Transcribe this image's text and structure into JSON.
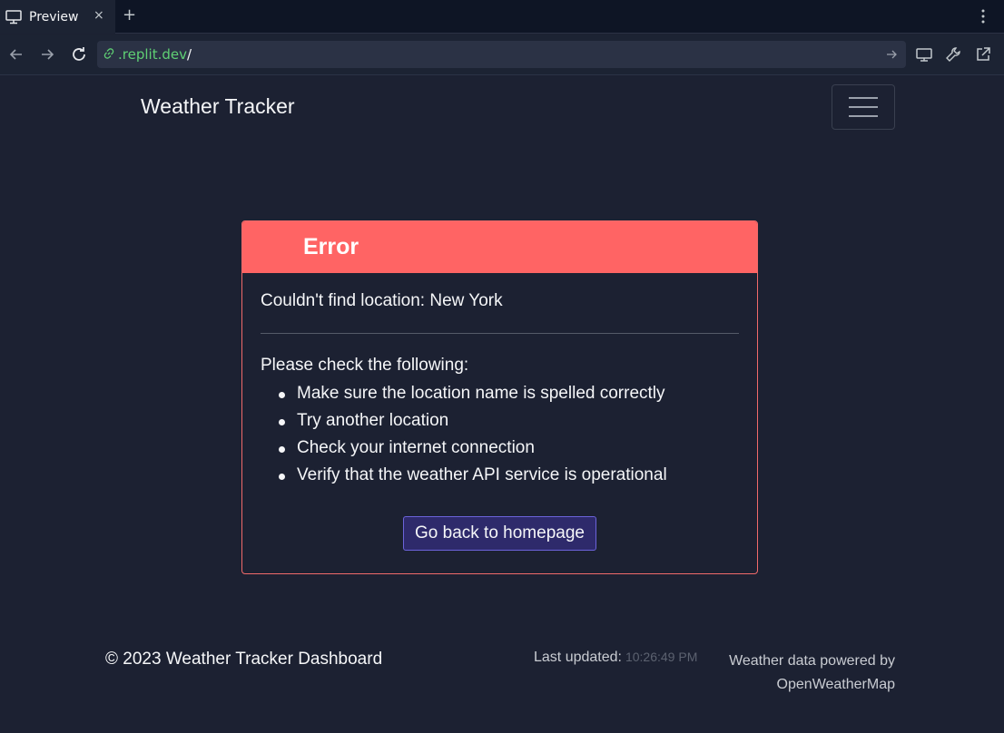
{
  "browser": {
    "tab": {
      "title": "Preview",
      "close": "×"
    },
    "new_tab": "+",
    "url": {
      "host": ".replit.dev",
      "path": "/"
    }
  },
  "app": {
    "brand": "Weather Tracker",
    "error": {
      "title": "Error",
      "message": "Couldn't find location: New York",
      "checks_title": "Please check the following:",
      "checks": [
        "Make sure the location name is spelled correctly",
        "Try another location",
        "Check your internet connection",
        "Verify that the weather API service is operational"
      ],
      "button": "Go back to homepage"
    },
    "footer": {
      "copyright": "© 2023 Weather Tracker Dashboard",
      "updated_label": "Last updated:",
      "updated_time": "10:26:49 PM",
      "powered": "Weather data powered by OpenWeatherMap"
    }
  },
  "colors": {
    "background": "#1c2132",
    "error_header": "#ff6464",
    "button_bg": "#2e2a6b",
    "button_border": "#6b63d9",
    "url_green": "#5fd074"
  }
}
